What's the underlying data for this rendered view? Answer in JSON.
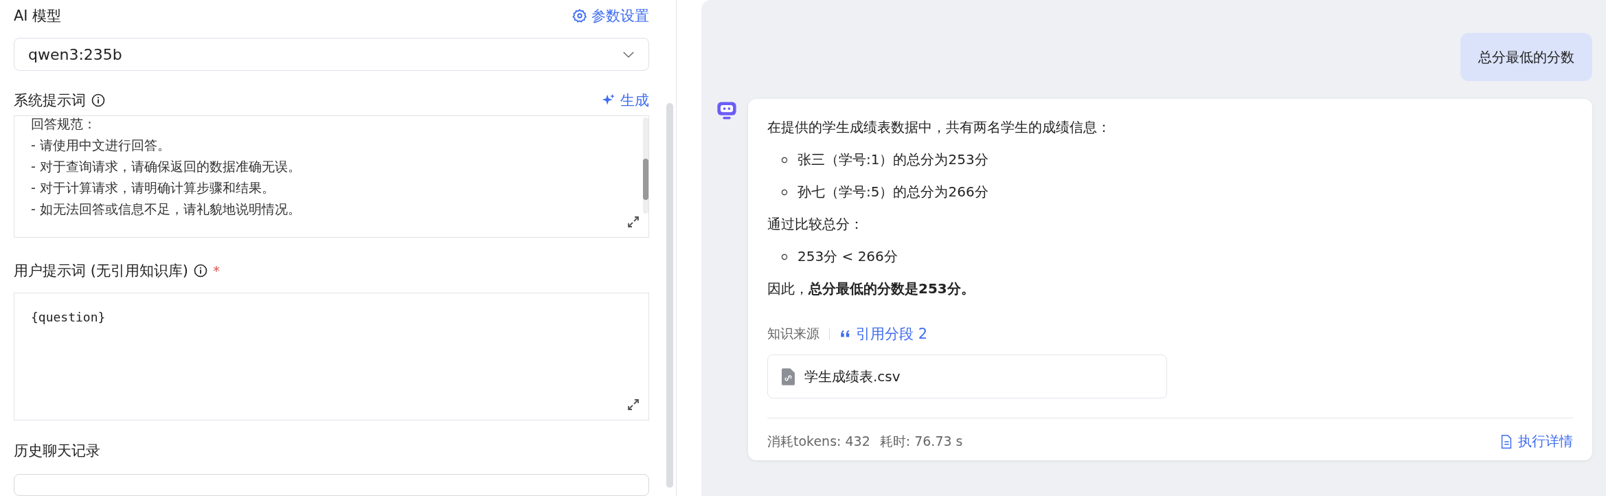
{
  "model_section": {
    "label": "AI 模型",
    "settings_link": "参数设置",
    "select_value": "qwen3:235b"
  },
  "system_prompt": {
    "label": "系统提示词",
    "generate_link": "生成",
    "lines": [
      "回答规范：",
      "- 请使用中文进行回答。",
      "- 对于查询请求，请确保返回的数据准确无误。",
      "- 对于计算请求，请明确计算步骤和结果。",
      "- 如无法回答或信息不足，请礼貌地说明情况。"
    ]
  },
  "user_prompt": {
    "label": "用户提示词 (无引用知识库)",
    "required_mark": "*",
    "value": "{question}"
  },
  "history": {
    "label": "历史聊天记录"
  },
  "chat": {
    "user_message": "总分最低的分数",
    "answer": [
      {
        "kind": "paragraph",
        "text": "在提供的学生成绩表数据中，共有两名学生的成绩信息："
      },
      {
        "kind": "bullet",
        "text": "张三（学号:1）的总分为253分"
      },
      {
        "kind": "bullet",
        "text": "孙七（学号:5）的总分为266分"
      },
      {
        "kind": "paragraph",
        "text": "通过比较总分："
      },
      {
        "kind": "bullet",
        "text": "253分 < 266分"
      },
      {
        "kind": "paragraph",
        "text": "因此，**总分最低的分数是253分。**"
      }
    ],
    "sources": {
      "label": "知识来源",
      "quote_link": "引用分段 2",
      "files": [
        "学生成绩表.csv"
      ]
    },
    "footer": {
      "tokens": "消耗tokens: 432",
      "time": "耗时: 76.73 s",
      "details_link": "执行详情"
    }
  }
}
